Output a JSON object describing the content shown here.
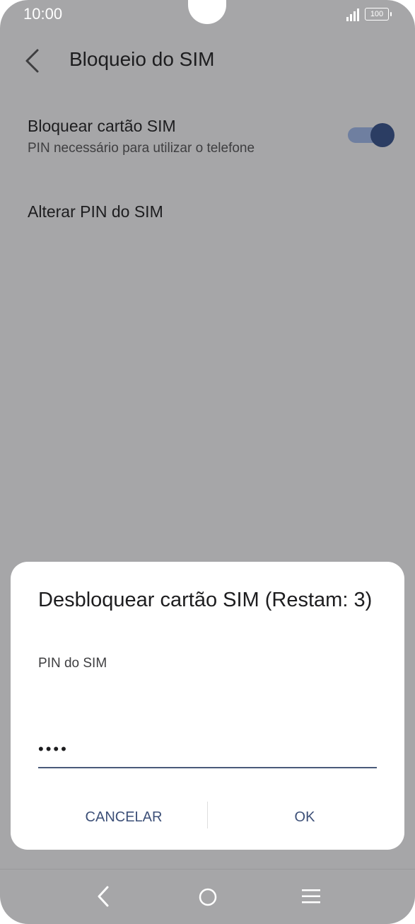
{
  "status_bar": {
    "time": "10:00",
    "battery": "100"
  },
  "header": {
    "title": "Bloqueio do SIM"
  },
  "settings": {
    "lock_sim": {
      "title": "Bloquear cartão SIM",
      "subtitle": "PIN necessário para utilizar o telefone",
      "enabled": true
    },
    "change_pin": {
      "title": "Alterar PIN do SIM"
    }
  },
  "dialog": {
    "title": "Desbloquear cartão SIM (Restam: 3)",
    "field_label": "PIN do SIM",
    "pin_masked": "••••",
    "cancel_label": "CANCELAR",
    "ok_label": "OK"
  },
  "colors": {
    "accent": "#3d5078",
    "toggle_thumb": "#2b3d63",
    "toggle_track": "#6f7fa0",
    "overlay": "#a6a6a8"
  },
  "icons": [
    "back-arrow-icon",
    "signal-icon",
    "battery-icon",
    "nav-back-icon",
    "nav-home-icon",
    "nav-menu-icon"
  ]
}
